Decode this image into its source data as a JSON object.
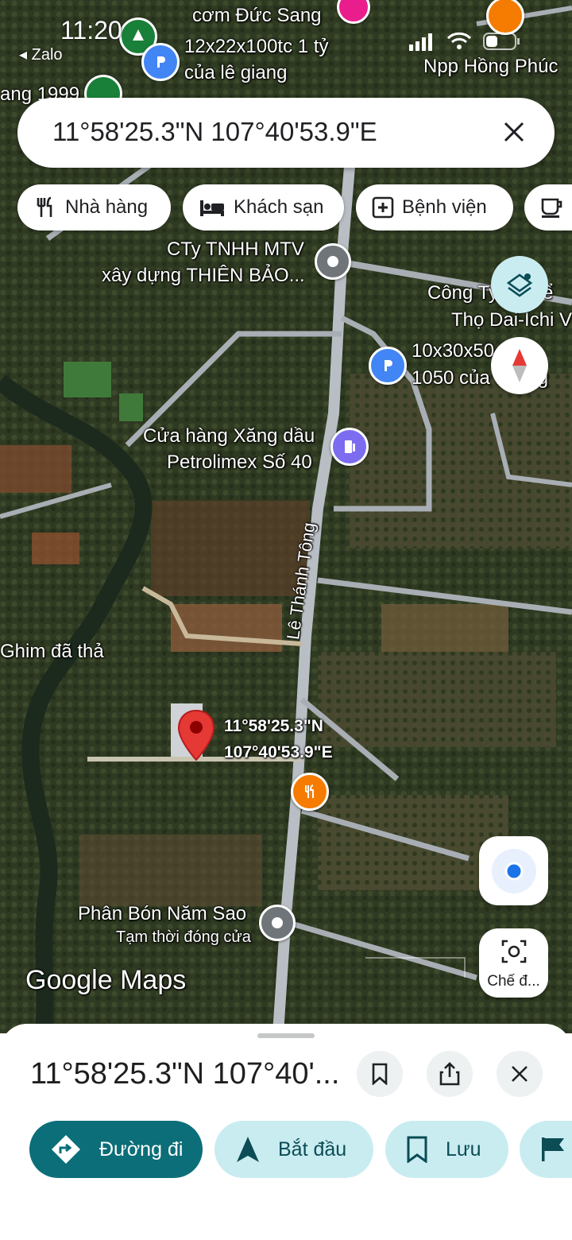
{
  "status_bar": {
    "time": "11:20",
    "back_app": "Zalo"
  },
  "map": {
    "labels": {
      "poi_restaurant_top": "cơm Đức Sang",
      "ad_top_line1": "12x22x100tc 1 tỷ",
      "ad_top_line2": "của lê giang",
      "npp": "Npp Hồng Phúc",
      "left_partial": "ang 1999",
      "cty_line1": "CTy TNHH MTV",
      "cty_line2": "xây dựng THIÊN BẢO...",
      "dai_ichi_line1": "Công Ty ... Hiể",
      "dai_ichi_line2": "Thọ Dai-Ichi V",
      "ad_mid_line1": "10x30x50... á",
      "ad_mid_line2": "1050 của ... ang",
      "petrol_line1": "Cửa hàng Xăng dầu",
      "petrol_line2": "Petrolimex Số 40",
      "road": "Lê Thánh Tông",
      "dropped_pin": "Ghim đã thả",
      "pin_coord_line1": "11°58'25.3\"N",
      "pin_coord_line2": "107°40'53.9\"E",
      "fertilizer": "Phân Bón Năm Sao",
      "fertilizer_status": "Tạm thời đóng cửa",
      "google_maps": "Google Maps"
    },
    "pin_color": "#e53935"
  },
  "search": {
    "query": "11°58'25.3\"N 107°40'53.9\"E"
  },
  "chips": [
    {
      "label": "Nhà hàng",
      "icon": "restaurant-icon"
    },
    {
      "label": "Khách sạn",
      "icon": "hotel-icon"
    },
    {
      "label": "Bệnh viện",
      "icon": "hospital-icon"
    },
    {
      "label": "",
      "icon": "coffee-icon"
    }
  ],
  "buttons": {
    "street_view_label": "Chế đ..."
  },
  "sheet": {
    "title": "11°58'25.3\"N 107°40'...",
    "actions": [
      {
        "label": "Đường đi",
        "icon": "directions-icon"
      },
      {
        "label": "Bắt đầu",
        "icon": "navigation-arrow-icon"
      },
      {
        "label": "Lưu",
        "icon": "bookmark-icon"
      },
      {
        "label": "",
        "icon": "flag-icon"
      }
    ]
  },
  "colors": {
    "accent": "#0b6e78",
    "accent_light": "#c9ecf1",
    "pin": "#e53935",
    "parking": "#4285f4",
    "food": "#f57c00",
    "gas": "#7c6cf0"
  }
}
